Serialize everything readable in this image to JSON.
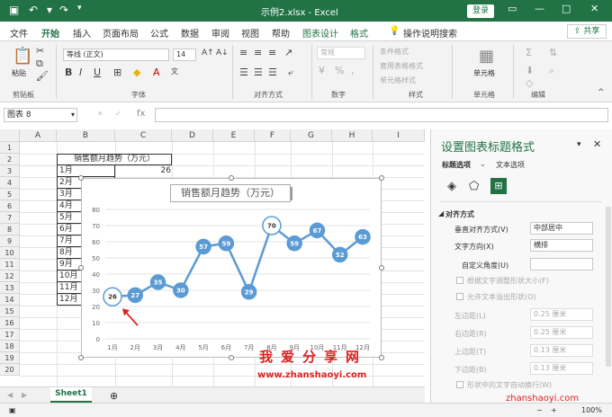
{
  "titlebar": {
    "title": "示例2.xlsx - Excel",
    "login": "登录",
    "save_icon": "save-icon",
    "undo_icon": "undo-icon",
    "redo_icon": "redo-icon"
  },
  "menu": {
    "tabs": [
      "文件",
      "开始",
      "插入",
      "页面布局",
      "公式",
      "数据",
      "审阅",
      "视图",
      "帮助",
      "图表设计",
      "格式"
    ],
    "active": "开始",
    "tell": "操作说明搜索",
    "share": "共享"
  },
  "ribbon": {
    "clipboard": {
      "paste": "粘贴",
      "label": "剪贴板"
    },
    "font": {
      "name": "等线 (正文)",
      "size": "14",
      "label": "字体"
    },
    "align": {
      "label": "对齐方式"
    },
    "number": {
      "format": "常规",
      "label": "数字"
    },
    "styles": {
      "cond": "条件格式",
      "table": "套用表格格式",
      "cell": "单元格样式",
      "label": "样式"
    },
    "cells": {
      "label": "单元格",
      "title": "单元格"
    },
    "edit": {
      "label": "编辑"
    }
  },
  "formula": {
    "namebox": "图表 8",
    "fx": "fx"
  },
  "grid": {
    "columns": [
      "A",
      "B",
      "C",
      "D",
      "E",
      "F",
      "G",
      "H",
      "I"
    ],
    "rows": [
      "1",
      "2",
      "3",
      "4",
      "5",
      "6",
      "7",
      "8",
      "9",
      "10",
      "11",
      "12",
      "13",
      "14",
      "15",
      "16",
      "17",
      "18",
      "19",
      "20"
    ],
    "table_header": "销售额月趋势（万元）",
    "months": [
      "1月",
      "2月",
      "3月",
      "4月",
      "5月",
      "6月",
      "7月",
      "8月",
      "9月",
      "10月",
      "11月",
      "12月"
    ],
    "first_value": "26"
  },
  "chart_data": {
    "type": "line",
    "title": "销售额月趋势（万元）",
    "categories": [
      "1月",
      "2月",
      "3月",
      "4月",
      "5月",
      "6月",
      "7月",
      "8月",
      "9月",
      "10月",
      "11月",
      "12月"
    ],
    "values": [
      26,
      27,
      35,
      30,
      57,
      59,
      29,
      70,
      59,
      67,
      52,
      63
    ],
    "ylim": [
      0,
      80
    ],
    "yticks": [
      "0",
      "10",
      "20",
      "30",
      "40",
      "50",
      "60",
      "70",
      "80"
    ],
    "line_color": "#5b9bd5",
    "highlight_points": [
      0,
      7
    ],
    "grid": true
  },
  "sheets": {
    "active": "Sheet1"
  },
  "pane": {
    "title": "设置图表标题格式",
    "tab_title": "标题选项",
    "tab_text": "文本选项",
    "section": "对齐方式",
    "vertical_label": "垂直对齐方式(V)",
    "vertical_value": "中部居中",
    "direction_label": "文字方向(X)",
    "direction_value": "横排",
    "angle_label": "自定义角度(U)",
    "resize_label": "根据文字调整形状大小(F)",
    "overflow_label": "允许文本溢出形状(O)",
    "left_label": "左边距(L)",
    "left_value": "0.25 厘米",
    "right_label": "右边距(R)",
    "right_value": "0.25 厘米",
    "top_label": "上边距(T)",
    "top_value": "0.13 厘米",
    "bottom_label": "下边距(B)",
    "bottom_value": "0.13 厘米",
    "wrap_label": "形状中的文字自动换行(W)"
  },
  "status": {
    "zoom": "100%"
  },
  "watermark": {
    "cn": "我爱分享网",
    "url": "www.zhanshaoyi.com",
    "url2": "zhanshaoyi.com"
  },
  "colors": {
    "accent": "#217346",
    "series": "#5b9bd5",
    "arrow": "#e02020"
  }
}
